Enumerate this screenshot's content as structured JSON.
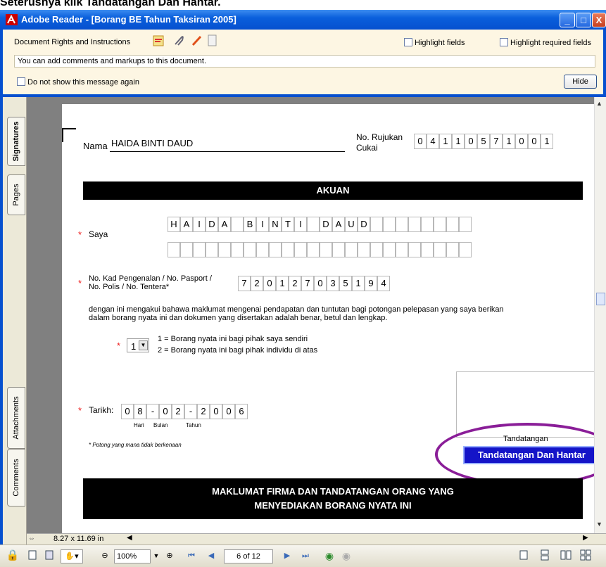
{
  "caption": "Seterusnya klik Tandatangan Dan Hantar.",
  "window": {
    "title": "Adobe Reader - [Borang BE Tahun Taksiran 2005]",
    "min": "_",
    "max": "□",
    "close": "X"
  },
  "docbar": {
    "rights": "Document Rights and Instructions",
    "highlight_fields": "Highlight fields",
    "highlight_required": "Highlight required fields",
    "message": "You can add comments and markups to this document.",
    "dont_show": "Do not show this message again",
    "hide": "Hide"
  },
  "leftbar": {
    "tabs": [
      "Signatures",
      "Pages",
      "Attachments",
      "Comments"
    ]
  },
  "form": {
    "nama_label": "Nama",
    "nama_value": "HAIDA BINTI DAUD",
    "rujukan_label1": "No. Rujukan",
    "rujukan_label2": "Cukai",
    "rujukan": [
      "0",
      "4",
      "1",
      "1",
      "0",
      "5",
      "7",
      "1",
      "0",
      "0",
      "1"
    ],
    "akuan": "AKUAN",
    "saya_label": "Saya",
    "star": "*",
    "saya_row1": [
      "H",
      "A",
      "I",
      "D",
      "A",
      "",
      "B",
      "I",
      "N",
      "T",
      "I",
      "",
      "D",
      "A",
      "U",
      "D",
      "",
      "",
      "",
      "",
      "",
      "",
      "",
      ""
    ],
    "kp_label1": "No. Kad Pengenalan / No. Pasport /",
    "kp_label2": "No. Polis / No. Tentera*",
    "kp": [
      "7",
      "2",
      "0",
      "1",
      "2",
      "7",
      "0",
      "3",
      "5",
      "1",
      "9",
      "4"
    ],
    "declaration1": "dengan ini mengakui bahawa maklumat mengenai pendapatan dan tuntutan bagi potongan pelepasan yang saya berikan",
    "declaration2": "dalam borang nyata ini dan dokumen yang disertakan adalah benar, betul dan lengkap.",
    "select_value": "1",
    "option1": "1 = Borang nyata ini bagi pihak saya sendiri",
    "option2": "2 = Borang nyata ini bagi pihak individu di atas",
    "tarikh_label": "Tarikh:",
    "tarikh": [
      "0",
      "8",
      "-",
      "0",
      "2",
      "-",
      "2",
      "0",
      "0",
      "6"
    ],
    "hari": "Hari",
    "bulan": "Bulan",
    "tahun": "Tahun",
    "potong": "* Potong yang mana tidak berkenaan",
    "tandatangan": "Tandatangan",
    "submit_button": "Tandatangan Dan Hantar",
    "maklumat1": "MAKLUMAT FIRMA DAN TANDATANGAN ORANG YANG",
    "maklumat2": "MENYEDIAKAN BORANG NYATA INI"
  },
  "statusbar": {
    "page_size": "8.27 x 11.69 in",
    "zoom": "100%",
    "page": "6 of 12"
  }
}
